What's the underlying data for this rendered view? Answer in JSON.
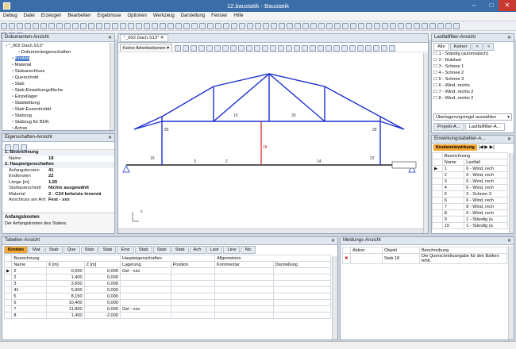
{
  "window": {
    "title": "12.baustatik - Baustatik",
    "min": "–",
    "max": "□",
    "close": "✕"
  },
  "menu": [
    "Debug",
    "Datei",
    "Erzeugen",
    "Bearbeiten",
    "Ergebnisse",
    "Optionen",
    "Werkzeug",
    "Darstellung",
    "Fenster",
    "Hilfe"
  ],
  "doc_explorer": {
    "title": "Dokumenten-Ansicht",
    "items": [
      {
        "label": "\"_002 Dach.S13\"",
        "indent": 0
      },
      {
        "label": "Dokumenteigenschaften",
        "indent": 2
      },
      {
        "label": "Knoten",
        "indent": 1,
        "selected": true
      },
      {
        "label": "Material",
        "indent": 1
      },
      {
        "label": "Stabanschluss",
        "indent": 1
      },
      {
        "label": "Querschnitt",
        "indent": 1
      },
      {
        "label": "Stab",
        "indent": 1
      },
      {
        "label": "Stab-Einwirkungsfläche",
        "indent": 1
      },
      {
        "label": "Einzellager",
        "indent": 1
      },
      {
        "label": "Stabbettung",
        "indent": 1
      },
      {
        "label": "Stab-Exzentrizität",
        "indent": 1
      },
      {
        "label": "Stabzug",
        "indent": 1
      },
      {
        "label": "Stabzug für BDK",
        "indent": 1
      },
      {
        "label": "Achse",
        "indent": 1
      }
    ]
  },
  "props": {
    "title": "Eigenschaften-Ansicht",
    "sec1": "1. Bezeichnung",
    "sec2": "2. Haupteigenschaften",
    "rows1": [
      {
        "k": "Name",
        "v": "18"
      }
    ],
    "rows2": [
      {
        "k": "Anfangsknoten",
        "v": "41"
      },
      {
        "k": "Endknoten",
        "v": "22"
      },
      {
        "k": "Länge [m]",
        "v": "1,55"
      },
      {
        "k": "Startquerschnitt",
        "v": "Nichts ausgewählt"
      },
      {
        "k": "Material",
        "v": "2 - C24 beheizte Innenrä"
      },
      {
        "k": "Anschluss am Anf.",
        "v": "Fest - xxx"
      }
    ],
    "desc_title": "Anfangsknoten",
    "desc_text": "Der Anfangsknoten des Stabes."
  },
  "editor": {
    "tab": "\"_002 Dach.S13\"",
    "workspace": "Keine Arbeitsebenen",
    "origin_label": "x"
  },
  "loadcase_filter": {
    "title": "Lastfallfilter-Ansicht",
    "tabs": [
      "Alle",
      "Keiner",
      "<",
      "<"
    ],
    "items": [
      "1 - Ständig (automatisch)",
      "2 - Nutzlast",
      "3 - Schnee 1",
      "4 - Schnee 2",
      "5 - Schnee 3",
      "6 - Wind, rechts",
      "7 - Wind, rechts 2",
      "8 - Wind, rechts 2"
    ],
    "dropdown": "Überlagerungsregel auswählen",
    "bottom_tabs": [
      "Projekt-A...",
      "Lastfallfilter-A..."
    ]
  },
  "einwirkung": {
    "title": "Einwirkungstabellen-A...",
    "button": "Knoteneinwirkung",
    "headers": [
      "Bezeichnung",
      "Name",
      "Lastfall"
    ],
    "rows": [
      [
        "1",
        "6 - Wind, rech"
      ],
      [
        "2",
        "6 - Wind, rech"
      ],
      [
        "3",
        "6 - Wind, rech"
      ],
      [
        "4",
        "6 - Wind, rech"
      ],
      [
        "5",
        "3 - Schnee 3"
      ],
      [
        "6",
        "6 - Wind, rech"
      ],
      [
        "7",
        "8 - Wind, rech"
      ],
      [
        "8",
        "6 - Wind, rech"
      ],
      [
        "9",
        "1 - Ständig (a"
      ],
      [
        "10",
        "1 - Ständig (a"
      ]
    ]
  },
  "table_view": {
    "title": "Tabellen-Ansicht",
    "tabs": [
      "Knoten",
      "Mat",
      "Stab",
      "Que",
      "Stab",
      "Stab",
      "Einz",
      "Stab",
      "Stab",
      "Stab",
      "Ach",
      "Last",
      "Line",
      "Nic"
    ],
    "group_headers": [
      "Bezeichnung",
      "Haupteigenschaften",
      "Allgemeines"
    ],
    "headers": [
      "Name",
      "X [m]",
      "Z [m]",
      "Lagerung",
      "Position",
      "Kommentar",
      "Darstellung"
    ],
    "rows": [
      [
        "2",
        "0,000",
        "0,000",
        "Gel - xxo"
      ],
      [
        "2",
        "1,400",
        "0,000",
        ""
      ],
      [
        "3",
        "3,650",
        "0,000",
        ""
      ],
      [
        "41",
        "5,900",
        "0,000",
        ""
      ],
      [
        "5",
        "8,150",
        "0,000",
        ""
      ],
      [
        "6",
        "10,400",
        "0,000",
        ""
      ],
      [
        "7",
        "11,800",
        "0,000",
        "Gel - xxo"
      ],
      [
        "8",
        "1,400",
        "-2,000",
        ""
      ]
    ]
  },
  "messages": {
    "title": "Meldungs-Ansicht",
    "headers": [
      "Aktion",
      "Objekt",
      "Beschreibung"
    ],
    "rows": [
      {
        "objekt": "Stab 18",
        "text": "Die Querschnittsangabe für den Balken fehlt."
      }
    ]
  },
  "accent": "#3b74c6",
  "highlight": "#f3a736"
}
